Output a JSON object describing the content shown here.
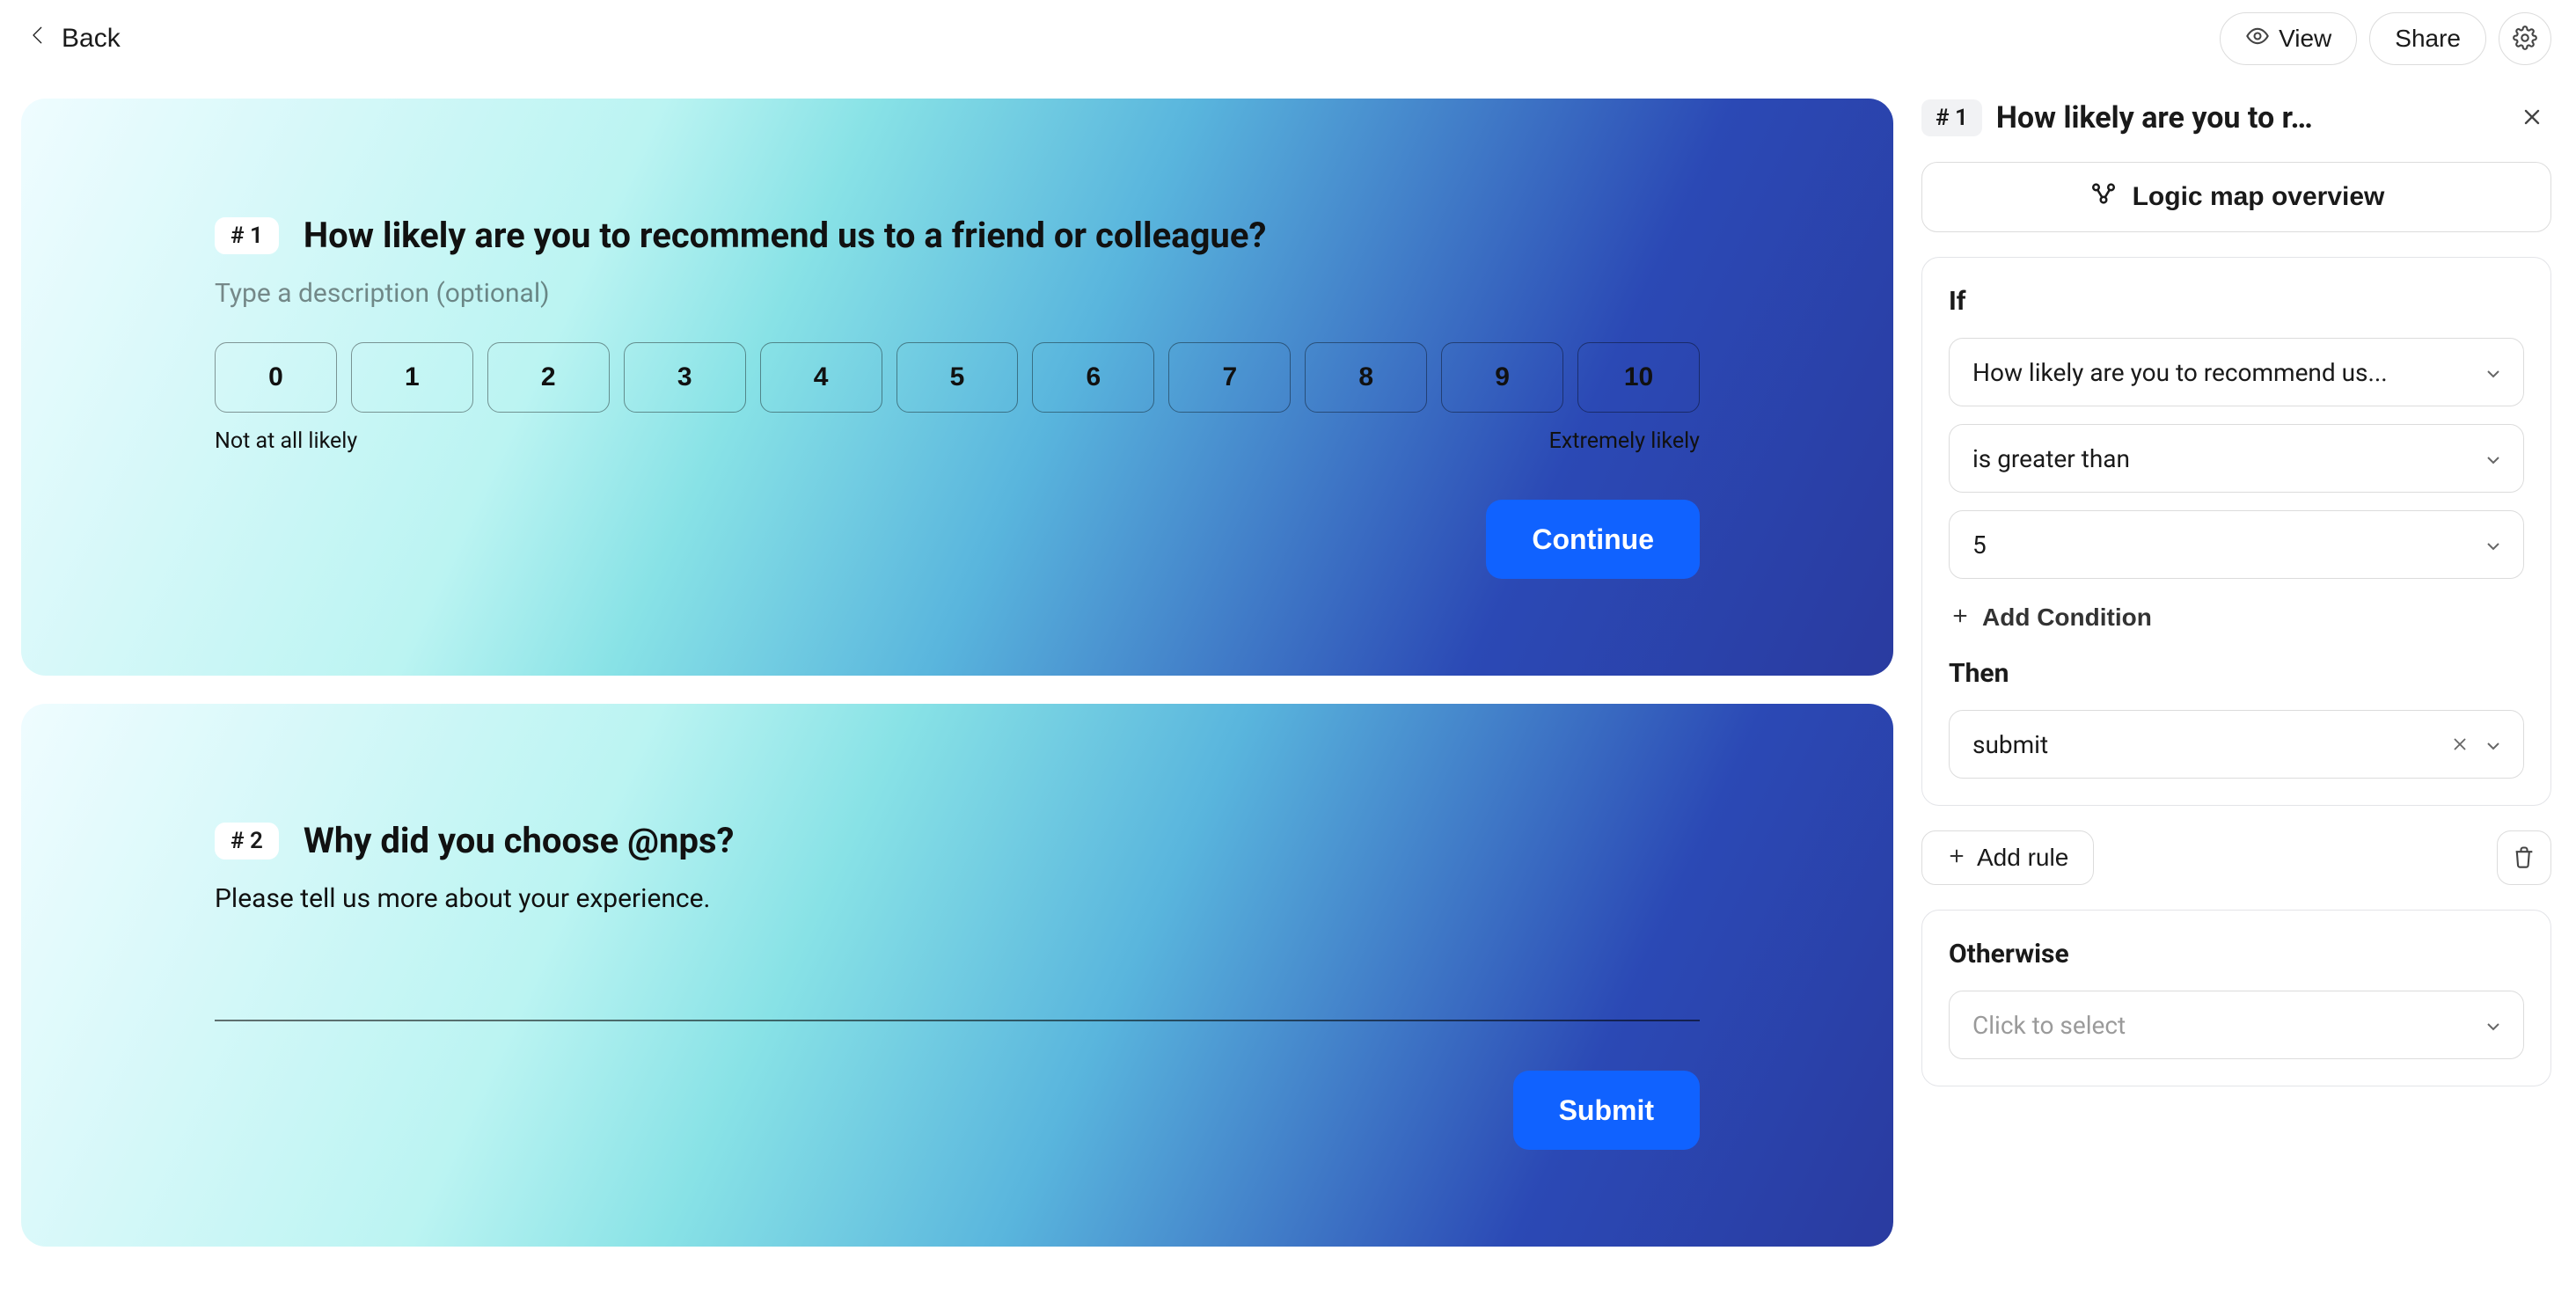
{
  "topbar": {
    "back_label": "Back",
    "view_label": "View",
    "share_label": "Share"
  },
  "questions": [
    {
      "badge": "# 1",
      "title": "How likely are you to recommend us to a friend or colleague?",
      "description_placeholder": "Type a description (optional)",
      "nps_options": [
        "0",
        "1",
        "2",
        "3",
        "4",
        "5",
        "6",
        "7",
        "8",
        "9",
        "10"
      ],
      "low_label": "Not at all likely",
      "high_label": "Extremely likely",
      "submit_label": "Continue"
    },
    {
      "badge": "# 2",
      "title": "Why did you choose @nps?",
      "subtext": "Please tell us more about your experience.",
      "submit_label": "Submit"
    }
  ],
  "logic": {
    "header_badge": "# 1",
    "header_title": "How likely are you to r…",
    "overview_label": "Logic map overview",
    "if_label": "If",
    "condition_field": "How likely are you to recommend us...",
    "condition_operator": "is greater than",
    "condition_value": "5",
    "add_condition_label": "Add Condition",
    "then_label": "Then",
    "then_action": "submit",
    "add_rule_label": "Add rule",
    "otherwise_label": "Otherwise",
    "otherwise_placeholder": "Click to select"
  }
}
